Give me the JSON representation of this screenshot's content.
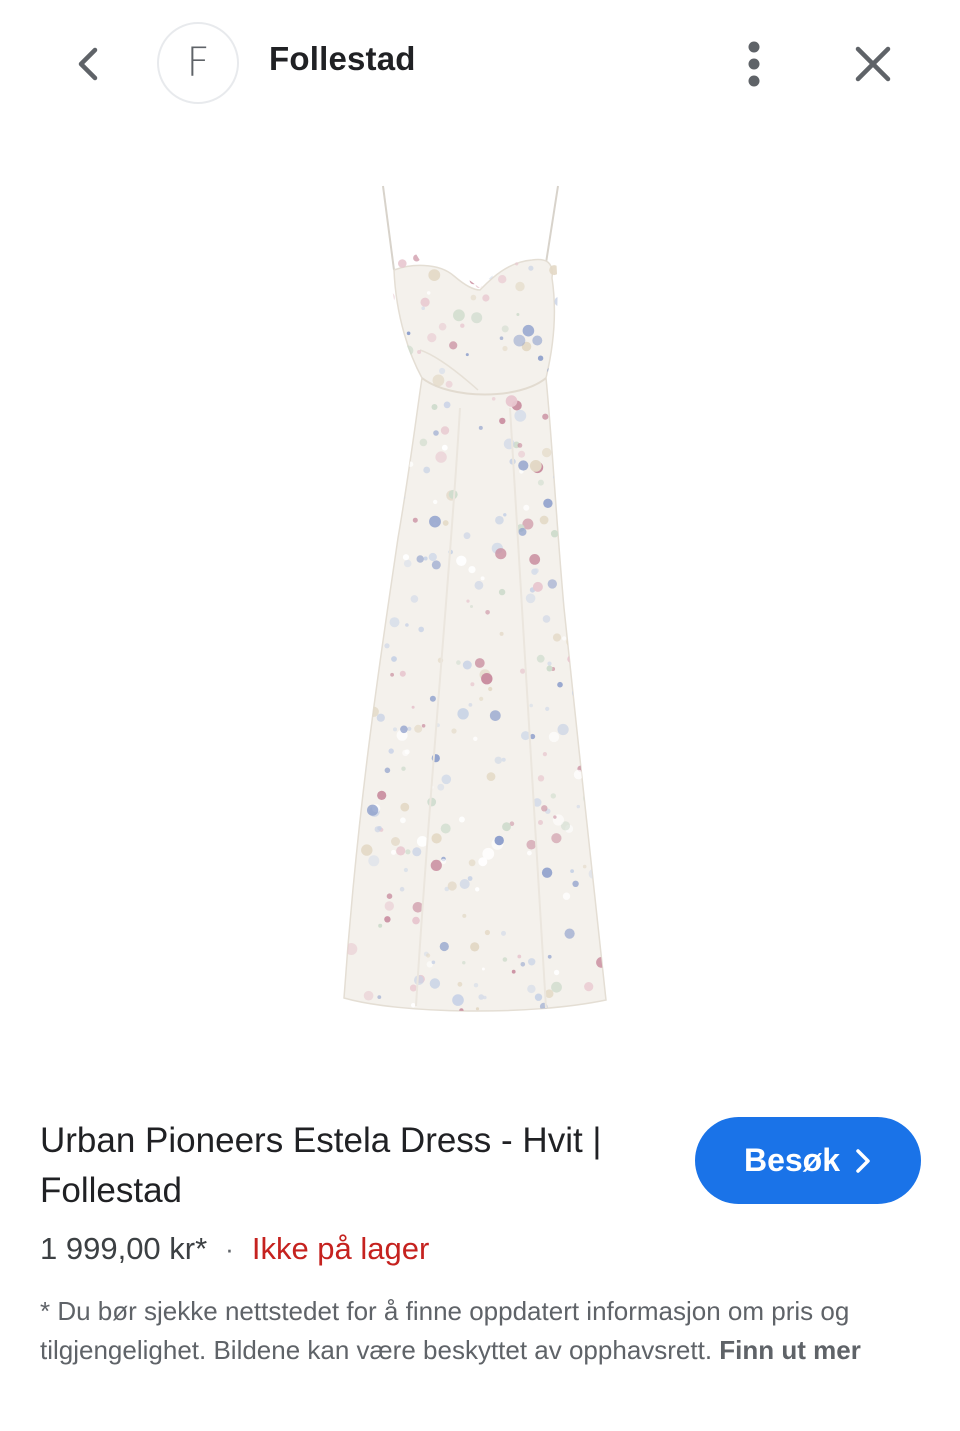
{
  "header": {
    "back_icon": "chevron-left-icon",
    "site_initial": "F",
    "site_name": "Follestad",
    "more_icon": "more-vert-icon",
    "close_icon": "close-icon"
  },
  "product": {
    "image_alt": "",
    "title": "Urban Pioneers Estela Dress - Hvit | Follestad",
    "price": "1 999,00 kr*",
    "separator": "·",
    "availability": "Ikke på lager",
    "visit_label": "Besøk",
    "visit_icon": "chevron-right-icon"
  },
  "disclaimer": {
    "text": "* Du bør sjekke nettstedet for å finne oppdatert informasjon om pris og tilgjengelighet. Bildene kan være beskyttet av opphavsrett. ",
    "link": "Finn ut mer"
  },
  "colors": {
    "accent": "#1a73e8",
    "out_of_stock": "#c5221f"
  }
}
